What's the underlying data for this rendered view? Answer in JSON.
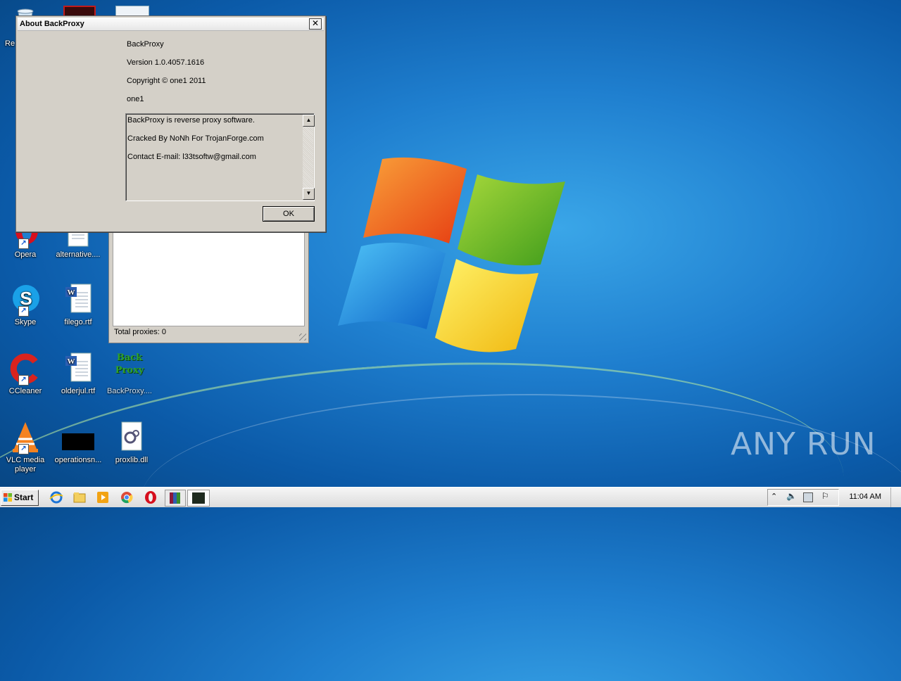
{
  "desktop": {
    "icons": [
      {
        "label": "Re",
        "icon": "recycle-bin-icon"
      },
      {
        "label": "Opera",
        "icon": "opera-icon"
      },
      {
        "label": "alternative....",
        "icon": "word-doc-icon"
      },
      {
        "label": "Skype",
        "icon": "skype-icon"
      },
      {
        "label": "filego.rtf",
        "icon": "word-doc-icon"
      },
      {
        "label": "CCleaner",
        "icon": "ccleaner-icon"
      },
      {
        "label": "olderjul.rtf",
        "icon": "word-doc-icon"
      },
      {
        "label": "BackProxy....",
        "icon": "backproxy-icon",
        "logo_text": "Back\nProxy"
      },
      {
        "label": "VLC media player",
        "icon": "vlc-icon"
      },
      {
        "label": "operationsn...",
        "icon": "black-file-icon"
      },
      {
        "label": "proxlib.dll",
        "icon": "dll-file-icon"
      }
    ]
  },
  "main_window": {
    "status_text": "Total proxies:  0"
  },
  "about_dialog": {
    "title": "About BackProxy",
    "close_glyph": "✕",
    "product_name": "BackProxy",
    "version": "Version 1.0.4057.1616",
    "copyright": "Copyright © one1 2011",
    "company": "one1",
    "description_lines": [
      "BackProxy is reverse proxy software.",
      "Cracked By NoNh For TrojanForge.com",
      "Contact E-mail: l33tsoftw@gmail.com"
    ],
    "ok_label": "OK"
  },
  "watermark": {
    "text": "ANY RUN"
  },
  "taskbar": {
    "start_label": "Start",
    "pinned": [
      "internet-explorer-icon",
      "explorer-icon",
      "media-player-icon",
      "chrome-icon",
      "opera-icon",
      "winrar-icon",
      "backproxy-icon"
    ],
    "tray_icons": [
      "show-hidden-icon",
      "volume-icon",
      "network-icon",
      "action-center-flag-icon"
    ],
    "clock": "11:04 AM"
  }
}
